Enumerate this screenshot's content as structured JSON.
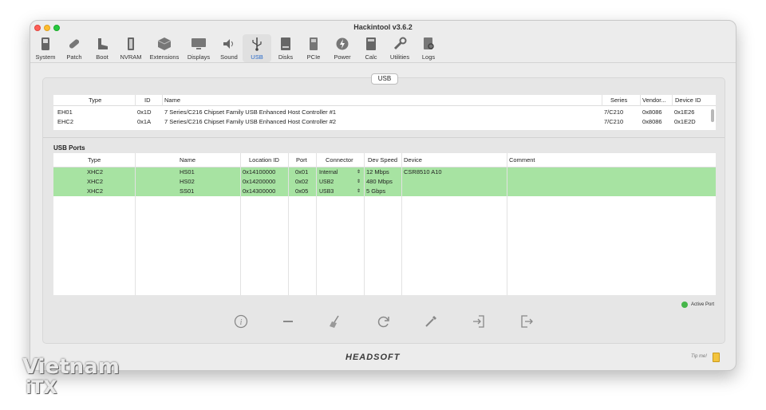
{
  "window": {
    "title": "Hackintool v3.6.2"
  },
  "toolbar": {
    "items": [
      {
        "label": "System",
        "icon": "system-icon"
      },
      {
        "label": "Patch",
        "icon": "patch-icon"
      },
      {
        "label": "Boot",
        "icon": "boot-icon"
      },
      {
        "label": "NVRAM",
        "icon": "nvram-icon"
      },
      {
        "label": "Extensions",
        "icon": "extensions-icon"
      },
      {
        "label": "Displays",
        "icon": "displays-icon"
      },
      {
        "label": "Sound",
        "icon": "sound-icon"
      },
      {
        "label": "USB",
        "icon": "usb-icon",
        "active": true
      },
      {
        "label": "Disks",
        "icon": "disks-icon"
      },
      {
        "label": "PCIe",
        "icon": "pcie-icon"
      },
      {
        "label": "Power",
        "icon": "power-icon"
      },
      {
        "label": "Calc",
        "icon": "calc-icon"
      },
      {
        "label": "Utilities",
        "icon": "utilities-icon"
      },
      {
        "label": "Logs",
        "icon": "logs-icon"
      }
    ]
  },
  "segment": {
    "label": "USB"
  },
  "controllers": {
    "headers": [
      "Type",
      "ID",
      "Name",
      "Series",
      "Vendor...",
      "Device ID"
    ],
    "rows": [
      {
        "type": "EH01",
        "id": "0x1D",
        "name": "7 Series/C216 Chipset Family USB Enhanced Host Controller #1",
        "series": "7/C210",
        "vendor": "0x8086",
        "device": "0x1E26"
      },
      {
        "type": "EHC2",
        "id": "0x1A",
        "name": "7 Series/C216 Chipset Family USB Enhanced Host Controller #2",
        "series": "7/C210",
        "vendor": "0x8086",
        "device": "0x1E2D"
      }
    ]
  },
  "ports": {
    "title": "USB Ports",
    "headers": [
      "Type",
      "Name",
      "Location ID",
      "Port",
      "Connector",
      "Dev Speed",
      "Device",
      "Comment"
    ],
    "rows": [
      {
        "type": "XHC2",
        "name": "HS01",
        "location": "0x14100000",
        "port": "0x01",
        "connector": "Internal",
        "speed": "12 Mbps",
        "device": "CSR8510 A10",
        "comment": ""
      },
      {
        "type": "XHC2",
        "name": "HS02",
        "location": "0x14200000",
        "port": "0x02",
        "connector": "USB2",
        "speed": "480 Mbps",
        "device": "",
        "comment": ""
      },
      {
        "type": "XHC2",
        "name": "SS01",
        "location": "0x14300000",
        "port": "0x05",
        "connector": "USB3",
        "speed": "5 Gbps",
        "device": "",
        "comment": ""
      }
    ]
  },
  "legend": {
    "label": "Active Port",
    "color": "#46b64a"
  },
  "actions": [
    "info-icon",
    "minus-icon",
    "broom-icon",
    "refresh-icon",
    "eyedropper-icon",
    "import-icon",
    "export-icon"
  ],
  "footer": {
    "brand": "HEADSOFT",
    "tip": "Tip me!"
  },
  "watermark": {
    "line1": "Vietnam",
    "line2": "iTX"
  },
  "colors": {
    "active_row": "#a7e3a2",
    "accent": "#2366c7"
  }
}
